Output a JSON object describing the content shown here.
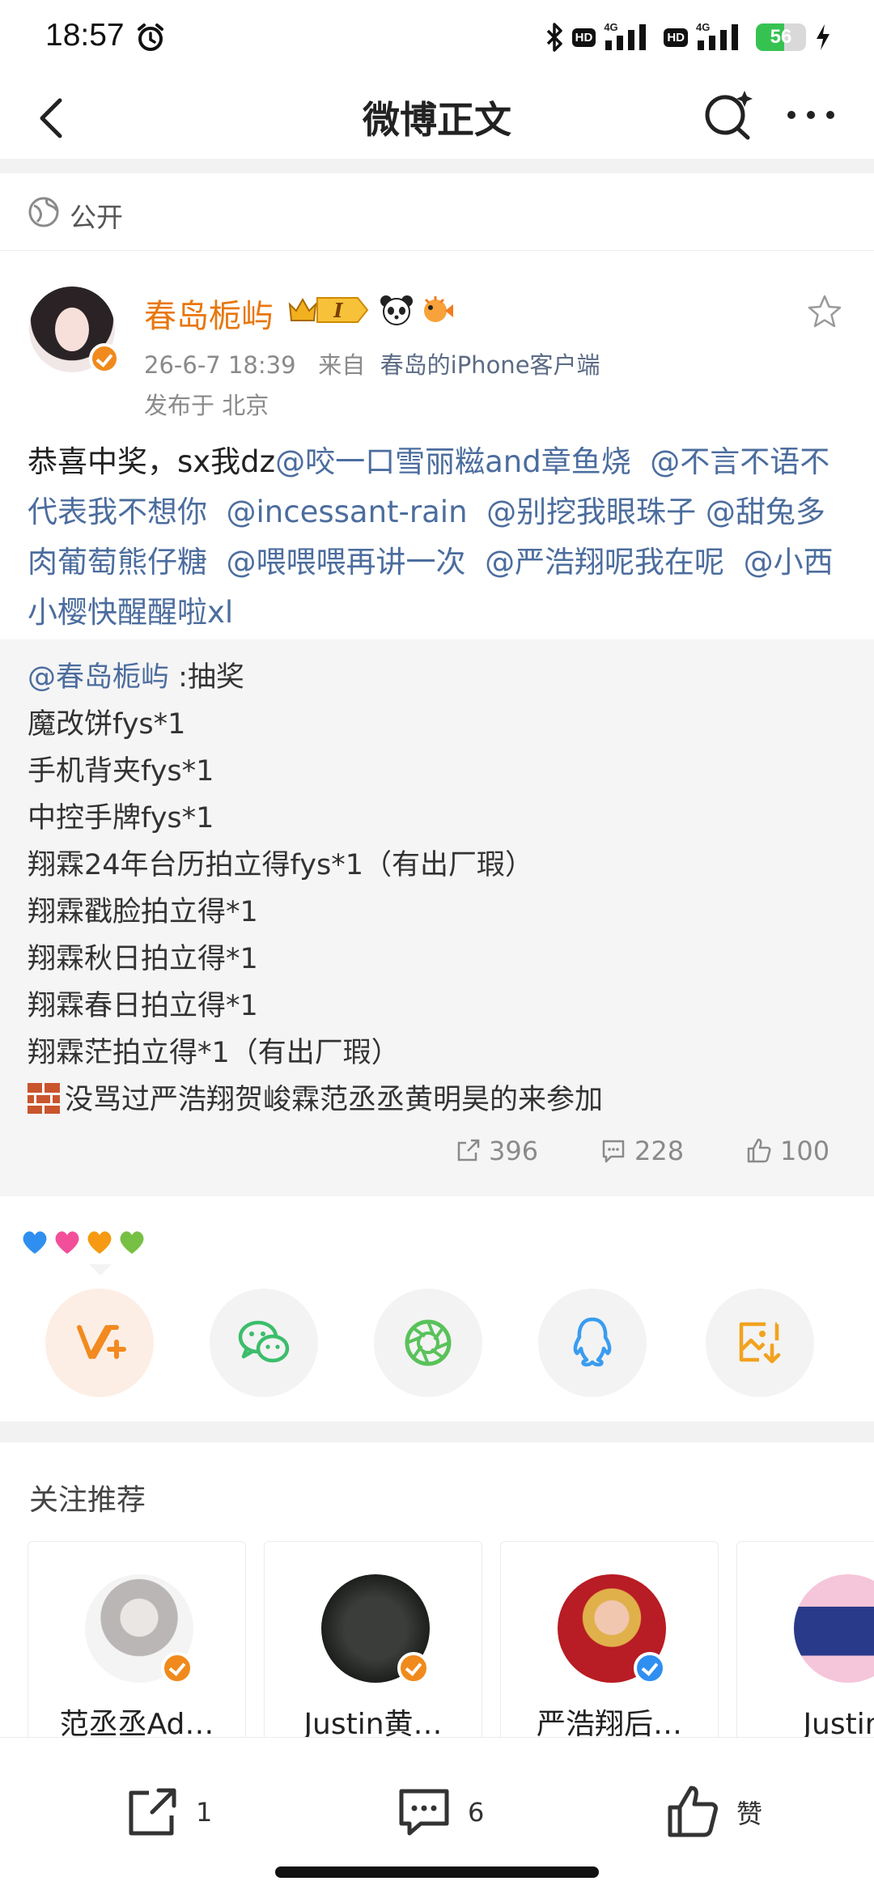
{
  "status_bar": {
    "time": "18:57",
    "hd1": "HD",
    "net1": "4G",
    "hd2": "HD",
    "net2": "4G",
    "battery": "56",
    "battery_level": 0.56
  },
  "nav": {
    "title": "微博正文"
  },
  "visibility": "公开",
  "post": {
    "username": "春岛栀屿",
    "level_badge": "I",
    "date": "26-6-7 18:39",
    "source_prefix": "来自",
    "source_client": "春岛的iPhone客户端",
    "location": "发布于 北京",
    "text_plain": "恭喜中奖，sx我dz",
    "mentions": [
      "@咬一口雪丽糍and章鱼烧",
      "@不言不语不代表我不想你",
      "@incessant-rain",
      "@别挖我眼珠子",
      "@甜兔多肉葡萄熊仔糖",
      "@喂喂喂再讲一次",
      "@严浩翔呢我在呢",
      "@小西小樱快醒醒啦xl"
    ]
  },
  "repost": {
    "author": "@春岛栀屿",
    "author_suffix": " :抽奖",
    "lines": [
      "魔改饼fys*1",
      "手机背夹fys*1",
      "中控手牌fys*1",
      "翔霖24年台历拍立得fys*1（有出厂瑕）",
      "翔霖戳脸拍立得*1",
      "翔霖秋日拍立得*1",
      "翔霖春日拍立得*1",
      "翔霖茫拍立得*1（有出厂瑕）"
    ],
    "last_line": "没骂过严浩翔贺峻霖范丞丞黄明昊的来参加",
    "reposts": "396",
    "comments": "228",
    "likes": "100"
  },
  "share": {
    "icons": [
      "weibo-repost-icon",
      "wechat-icon",
      "moments-icon",
      "qq-icon",
      "save-image-icon"
    ]
  },
  "recommend": {
    "title": "关注推荐",
    "cards": [
      {
        "name": "范丞丞Ad…"
      },
      {
        "name": "Justin黄…"
      },
      {
        "name": "严浩翔后…"
      },
      {
        "name": "Justin黄"
      }
    ]
  },
  "bottom": {
    "repost_count": "1",
    "comment_count": "6",
    "like_label": "赞"
  },
  "colors": {
    "username": "#e8770e",
    "mention": "#4c6d9e",
    "repost_bg": "#f5f5f5",
    "accent_orange": "#f08a1c"
  }
}
